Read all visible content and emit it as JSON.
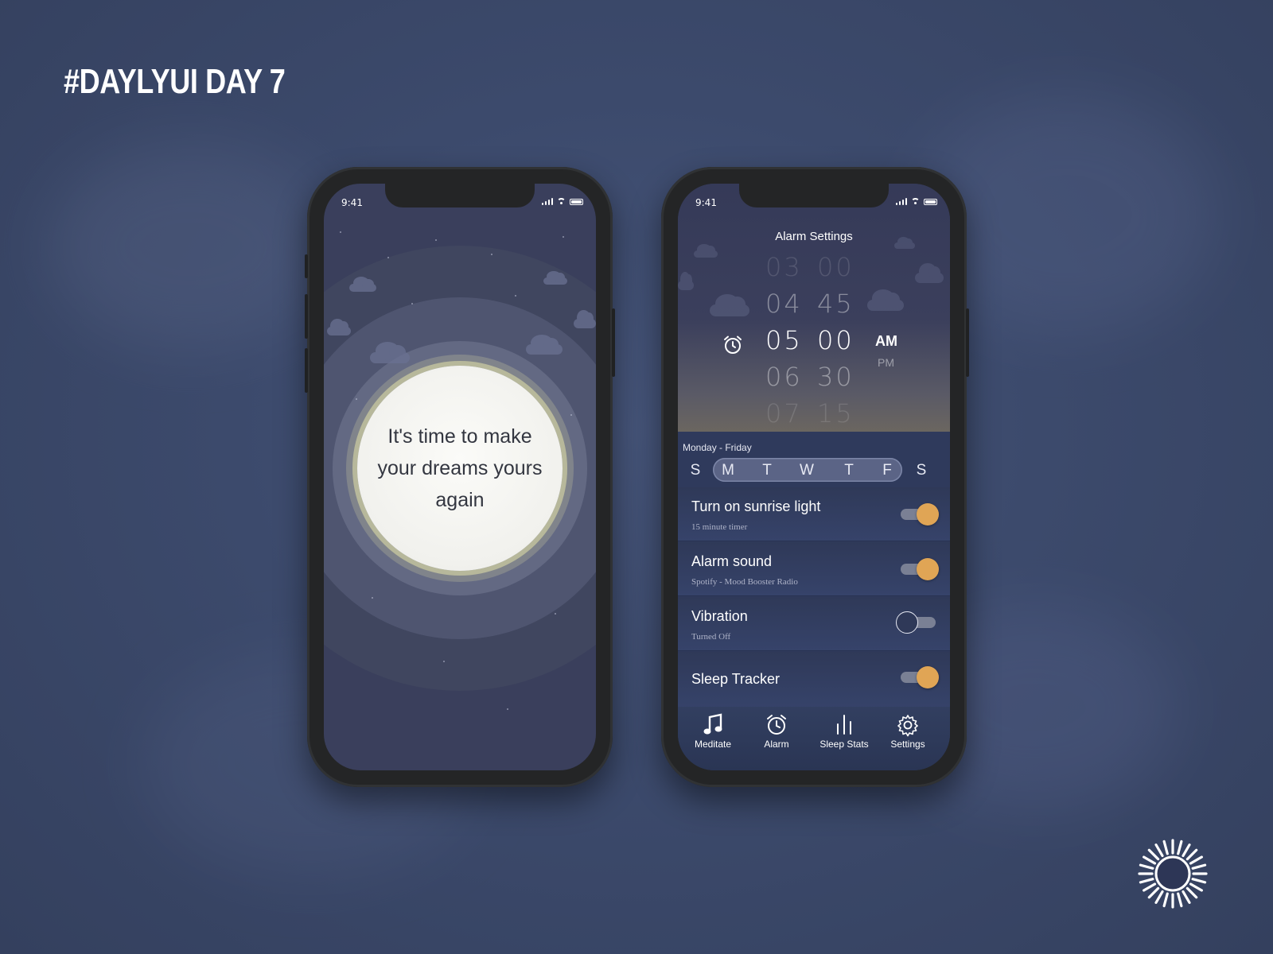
{
  "headline": "#DAYLYUI DAY 7",
  "left_phone": {
    "status_time": "9:41",
    "message": "It's time to make your dreams yours again"
  },
  "right_phone": {
    "status_time": "9:41",
    "title": "Alarm Settings",
    "time_picker": [
      {
        "hour": "03",
        "minute": "00",
        "state": "far"
      },
      {
        "hour": "04",
        "minute": "45",
        "state": "near"
      },
      {
        "hour": "05",
        "minute": "00",
        "state": "selected"
      },
      {
        "hour": "06",
        "minute": "30",
        "state": "near"
      },
      {
        "hour": "07",
        "minute": "15",
        "state": "far"
      }
    ],
    "meridiem": {
      "selected": "AM",
      "other": "PM"
    },
    "day_range": "Monday - Friday",
    "days": [
      "S",
      "M",
      "T",
      "W",
      "T",
      "F",
      "S"
    ],
    "settings": [
      {
        "title": "Turn on sunrise light",
        "subtitle": "15 minute timer",
        "on": true,
        "icon": "toggle"
      },
      {
        "title": "Alarm sound",
        "subtitle": "Spotify - Mood Booster Radio",
        "on": true,
        "icon": "toggle"
      },
      {
        "title": "Vibration",
        "subtitle": "Turned Off",
        "on": false,
        "icon": "toggle"
      },
      {
        "title": "Sleep Tracker",
        "subtitle": "",
        "on": true,
        "icon": "toggle"
      }
    ],
    "tabs": [
      {
        "label": "Meditate",
        "icon": "music-note-icon"
      },
      {
        "label": "Alarm",
        "icon": "alarm-clock-icon"
      },
      {
        "label": "Sleep Stats",
        "icon": "bar-chart-icon"
      },
      {
        "label": "Settings",
        "icon": "gear-icon"
      }
    ]
  },
  "colors": {
    "background": "#3c4a6c",
    "accent_toggle": "#e0a555",
    "phone_body": "#242526",
    "moon": "#f4f4f0"
  },
  "logo_icon": "sun-icon"
}
